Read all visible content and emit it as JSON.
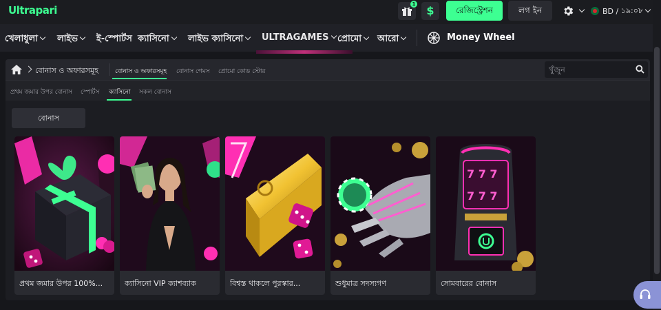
{
  "brand": {
    "logo_text": "Ultrapari",
    "accent": "#3dff92"
  },
  "header": {
    "gift_badge": "1",
    "dollar_label": "$",
    "register_label": "রেজিস্ট্রেশন",
    "login_label": "লগ ইন",
    "region": {
      "country": "BD",
      "time": "১৯:০৮"
    }
  },
  "nav": {
    "items": [
      {
        "label": "খেলাধুলা"
      },
      {
        "label": "লাইভ"
      },
      {
        "label": "ই-স্পোর্টস"
      },
      {
        "label": "ক্যাসিনো"
      },
      {
        "label": "লাইভ ক্যাসিনো"
      },
      {
        "label": "ULTRAGAMES"
      },
      {
        "label": "প্রোমো"
      },
      {
        "label": "আরো"
      }
    ],
    "money_wheel_label": "Money Wheel"
  },
  "breadcrumb": {
    "label": "বোনাস ও অফারসমূহ"
  },
  "subtabs": [
    {
      "label": "বোনাস ও অফারসমূহ",
      "active": true
    },
    {
      "label": "বোনাস গেমস",
      "active": false
    },
    {
      "label": "প্রোমো কোড স্টোর",
      "active": false
    }
  ],
  "search": {
    "placeholder": "খুঁজুন"
  },
  "filters": [
    {
      "label": "প্রথম জমার উপর বোনাস",
      "active": false
    },
    {
      "label": "স্পোর্টস",
      "active": false
    },
    {
      "label": "ক্যাসিনো",
      "active": true
    },
    {
      "label": "সকল বোনাস",
      "active": false
    }
  ],
  "bonus_chip": "বোনাস",
  "cards": [
    {
      "title": "প্রথম জমার উপর 100%...",
      "icon": "gift-box-art"
    },
    {
      "title": "ক্যাসিনো VIP ক্যাশব্যাক",
      "icon": "vip-woman-art"
    },
    {
      "title": "বিশ্বস্ত থাকলে পুরস্কার...",
      "icon": "gold-bar-art"
    },
    {
      "title": "শুধুমাত্র সদস্যগণ",
      "icon": "robot-hand-art"
    },
    {
      "title": "সোমবারের বোনাস",
      "icon": "slot-machine-art"
    }
  ]
}
